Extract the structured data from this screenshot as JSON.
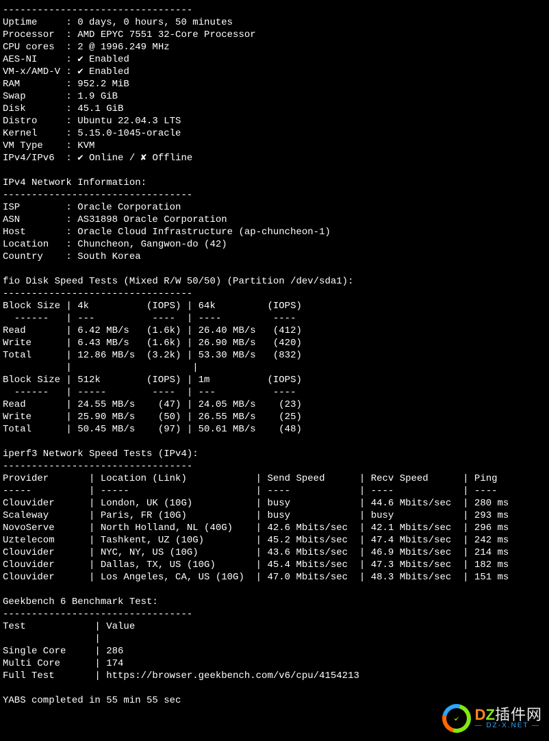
{
  "dash_line_short": "---------------------------------",
  "sysinfo": [
    [
      "Uptime",
      "0 days, 0 hours, 50 minutes"
    ],
    [
      "Processor",
      "AMD EPYC 7551 32-Core Processor"
    ],
    [
      "CPU cores",
      "2 @ 1996.249 MHz"
    ],
    [
      "AES-NI",
      "✔ Enabled"
    ],
    [
      "VM-x/AMD-V",
      "✔ Enabled"
    ],
    [
      "RAM",
      "952.2 MiB"
    ],
    [
      "Swap",
      "1.9 GiB"
    ],
    [
      "Disk",
      "45.1 GiB"
    ],
    [
      "Distro",
      "Ubuntu 22.04.3 LTS"
    ],
    [
      "Kernel",
      "5.15.0-1045-oracle"
    ],
    [
      "VM Type",
      "KVM"
    ],
    [
      "IPv4/IPv6",
      "✔ Online / ✘ Offline"
    ]
  ],
  "ipv4_header": "IPv4 Network Information:",
  "ipv4_dash": "---------------------------------",
  "ipv4": [
    [
      "ISP",
      "Oracle Corporation"
    ],
    [
      "ASN",
      "AS31898 Oracle Corporation"
    ],
    [
      "Host",
      "Oracle Cloud Infrastructure (ap-chuncheon-1)"
    ],
    [
      "Location",
      "Chuncheon, Gangwon-do (42)"
    ],
    [
      "Country",
      "South Korea"
    ]
  ],
  "fio_title": "fio Disk Speed Tests (Mixed R/W 50/50) (Partition /dev/sda1):",
  "fio_dash": "---------------------------------",
  "fio_table1": {
    "header": [
      "Block Size",
      "4k",
      "(IOPS)",
      "64k",
      "(IOPS)"
    ],
    "sep": [
      "  ------",
      "---",
      "---- ",
      "----",
      "---- "
    ],
    "rows": [
      [
        "Read",
        "6.42 MB/s",
        "(1.6k)",
        "26.40 MB/s",
        "(412)"
      ],
      [
        "Write",
        "6.43 MB/s",
        "(1.6k)",
        "26.90 MB/s",
        "(420)"
      ],
      [
        "Total",
        "12.86 MB/s",
        "(3.2k)",
        "53.30 MB/s",
        "(832)"
      ]
    ]
  },
  "fio_table2": {
    "header": [
      "Block Size",
      "512k",
      "(IOPS)",
      "1m",
      "(IOPS)"
    ],
    "sep": [
      "  ------",
      "-----",
      "---- ",
      "---",
      "---- "
    ],
    "rows": [
      [
        "Read",
        "24.55 MB/s",
        "(47)",
        "24.05 MB/s",
        "(23)"
      ],
      [
        "Write",
        "25.90 MB/s",
        "(50)",
        "26.55 MB/s",
        "(25)"
      ],
      [
        "Total",
        "50.45 MB/s",
        "(97)",
        "50.61 MB/s",
        "(48)"
      ]
    ]
  },
  "iperf_title": "iperf3 Network Speed Tests (IPv4):",
  "iperf_dash": "---------------------------------",
  "iperf_header": [
    "Provider",
    "Location (Link)",
    "Send Speed",
    "Recv Speed",
    "Ping"
  ],
  "iperf_rows": [
    [
      "Clouvider",
      "London, UK (10G)",
      "busy",
      "44.6 Mbits/sec",
      "280 ms"
    ],
    [
      "Scaleway",
      "Paris, FR (10G)",
      "busy",
      "busy",
      "293 ms"
    ],
    [
      "NovoServe",
      "North Holland, NL (40G)",
      "42.6 Mbits/sec",
      "42.1 Mbits/sec",
      "296 ms"
    ],
    [
      "Uztelecom",
      "Tashkent, UZ (10G)",
      "45.2 Mbits/sec",
      "47.4 Mbits/sec",
      "242 ms"
    ],
    [
      "Clouvider",
      "NYC, NY, US (10G)",
      "43.6 Mbits/sec",
      "46.9 Mbits/sec",
      "214 ms"
    ],
    [
      "Clouvider",
      "Dallas, TX, US (10G)",
      "45.4 Mbits/sec",
      "47.3 Mbits/sec",
      "182 ms"
    ],
    [
      "Clouvider",
      "Los Angeles, CA, US (10G)",
      "47.0 Mbits/sec",
      "48.3 Mbits/sec",
      "151 ms"
    ]
  ],
  "geekbench_title": "Geekbench 6 Benchmark Test:",
  "geekbench_dash": "---------------------------------",
  "geekbench_header": [
    "Test",
    "Value"
  ],
  "geekbench_rows": [
    [
      "Single Core",
      "286"
    ],
    [
      "Multi Core",
      "174"
    ],
    [
      "Full Test",
      "https://browser.geekbench.com/v6/cpu/4154213"
    ]
  ],
  "completion": "YABS completed in 55 min 55 sec",
  "watermark": {
    "brand_prefix": "D",
    "brand_suffix": "Z",
    "brand_cn": "插件网",
    "url": "— DZ-X.NET —"
  }
}
